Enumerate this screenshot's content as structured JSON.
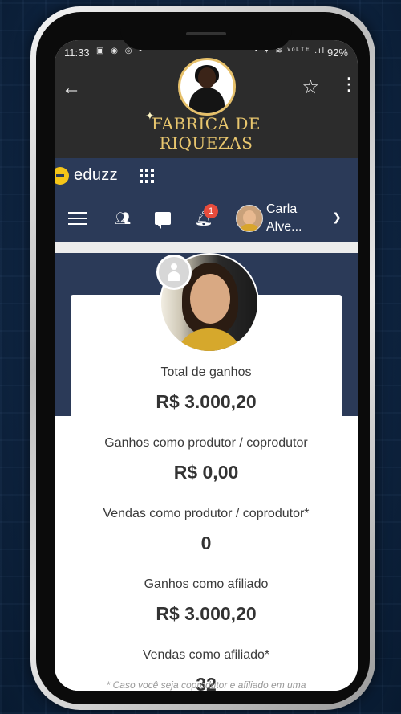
{
  "status_bar": {
    "time": "11:33",
    "left_icons": "▣ ◉ ◎ •",
    "right_icons": "▪ ✶ ≋ ᵛᵒᴸᵀᴱ .ıl",
    "battery": "92%"
  },
  "header": {
    "brand_line1": "FABRICA DE",
    "brand_line2": "RIQUEZAS",
    "back_icon": "arrow-left-icon",
    "star_icon": "star-outline-icon",
    "more_icon": "more-vertical-icon"
  },
  "eduzz": {
    "logo_text": "eduzz",
    "apps_icon": "apps-grid-icon"
  },
  "nav": {
    "notifications_count": "1",
    "user_name_line1": "Carla",
    "user_name_line2": "Alve..."
  },
  "stats": [
    {
      "label": "Total de ganhos",
      "value": "R$ 3.000,20"
    },
    {
      "label": "Ganhos como produtor / coprodutor",
      "value": "R$ 0,00"
    },
    {
      "label": "Vendas como produtor / coprodutor*",
      "value": "0"
    },
    {
      "label": "Ganhos como afiliado",
      "value": "R$ 3.000,20"
    },
    {
      "label": "Vendas como afiliado*",
      "value": "32"
    }
  ],
  "footnote": "* Caso você seja coprodutor e afiliado em uma",
  "colors": {
    "header_bg": "#2c2c2c",
    "brand_gold": "#e8c66e",
    "eduzz_navy": "#2b3a58",
    "eduzz_yellow": "#f5c518",
    "badge_red": "#e74c3c"
  }
}
